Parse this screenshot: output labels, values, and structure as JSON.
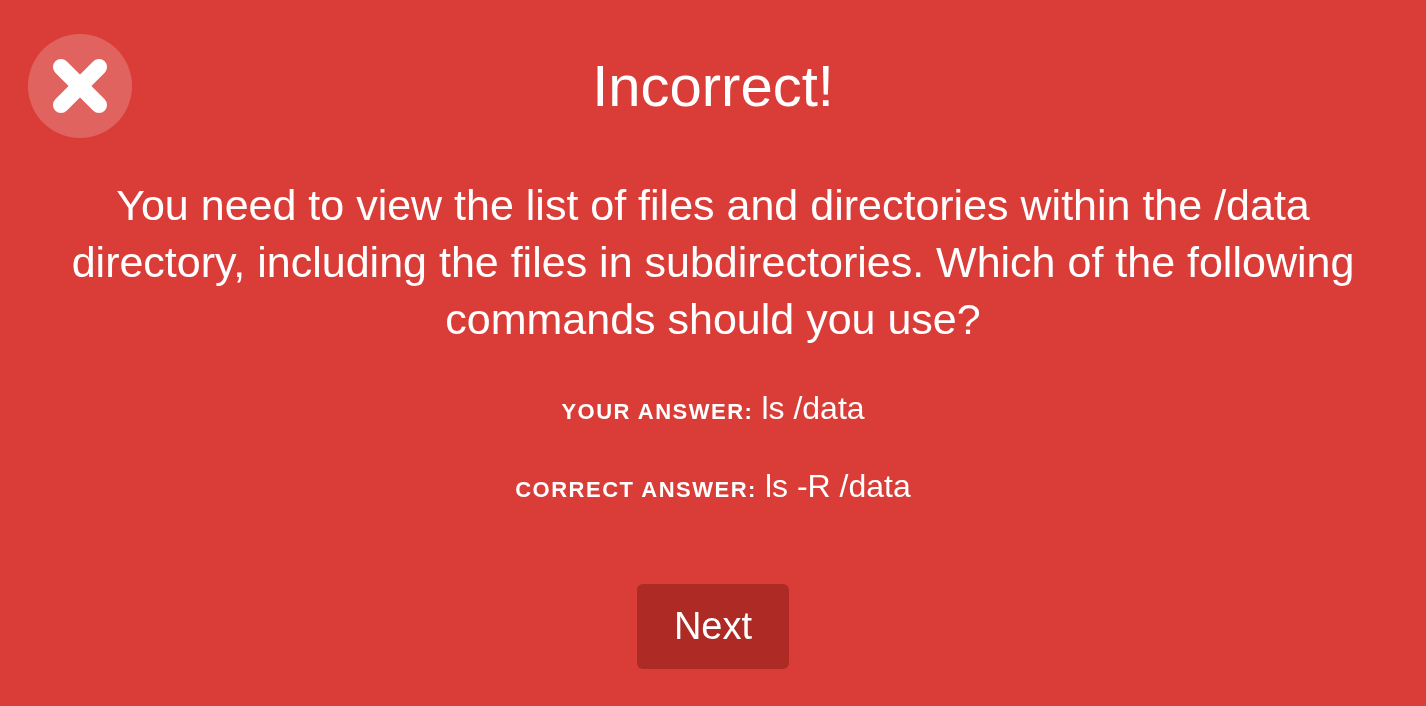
{
  "result": {
    "title": "Incorrect!",
    "correct": false
  },
  "question": "You need to view the list of files and directories within the /data directory, including the files in subdirectories. Which of the following commands should you use?",
  "answers": [
    {
      "label": "YOUR ANSWER:",
      "value": "ls /data"
    },
    {
      "label": "CORRECT ANSWER:",
      "value": "ls -R /data"
    }
  ],
  "next_button": {
    "label": "Next"
  }
}
